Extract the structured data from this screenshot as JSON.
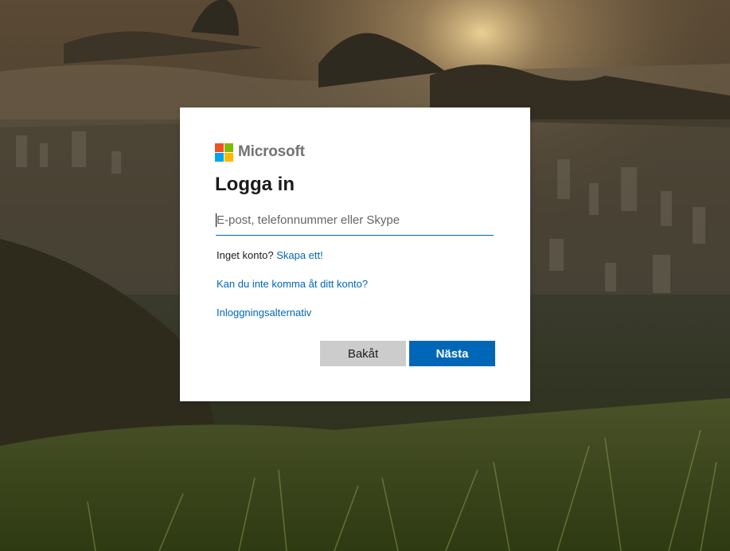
{
  "brand": {
    "name": "Microsoft",
    "logo_colors": [
      "#f25022",
      "#7fba00",
      "#00a4ef",
      "#ffb900"
    ]
  },
  "signin": {
    "title": "Logga in",
    "input_placeholder": "E-post, telefonnummer eller Skype",
    "input_value": "",
    "no_account_text": "Inget konto?",
    "create_account_link": "Skapa ett!",
    "cant_access_link": "Kan du inte komma åt ditt konto?",
    "signin_options_link": "Inloggningsalternativ",
    "back_button": "Bakåt",
    "next_button": "Nästa"
  },
  "colors": {
    "accent": "#0067b8",
    "back_button_bg": "#cccccc"
  }
}
